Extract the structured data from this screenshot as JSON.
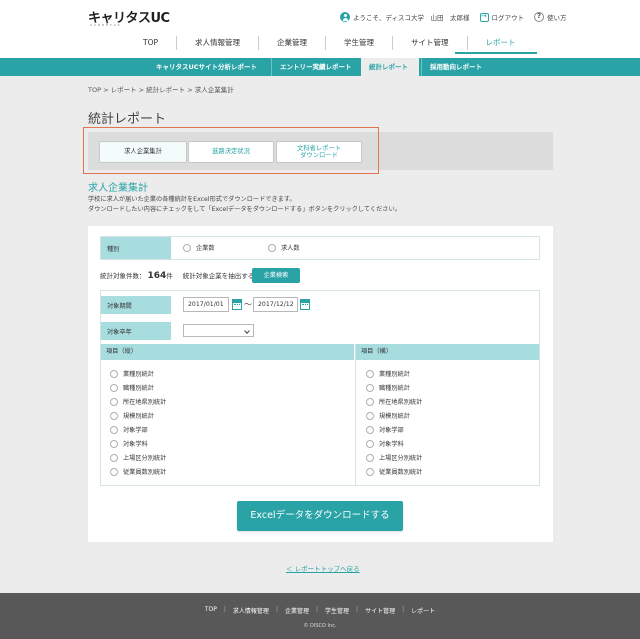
{
  "header": {
    "logo": "キャリタスUC",
    "logo_sub": "CAREETAS",
    "greeting": "ようこそ、ディスコ大学　山田　太郎様",
    "logout": "ログアウト",
    "help": "使い方"
  },
  "gnav": [
    "TOP",
    "求人情報管理",
    "企業管理",
    "学生管理",
    "サイト管理",
    "レポート"
  ],
  "subnav": [
    "キャリタスUCサイト分析レポート",
    "エントリー実績レポート",
    "統計レポート",
    "採用動向レポート"
  ],
  "breadcrumb": "TOP > レポート > 統計レポート > 求人企業集計",
  "page_title": "統計レポート",
  "tabs": {
    "t1": "求人企業集計",
    "t2": "進路決定状況",
    "t3_line1": "文科省レポート",
    "t3_line2": "ダウンロード"
  },
  "section_title": "求人企業集計",
  "description": {
    "line1": "学校に求人が届いた企業の各種統計をExcel形式でダウンロードできます。",
    "line2": "ダウンロードしたい内容にチェックをして「Excelデータをダウンロードする」ボタンをクリックしてください。"
  },
  "form": {
    "type_label": "種別",
    "type_opt1": "企業数",
    "type_opt2": "求人数",
    "count_label": "統計対象件数：",
    "count_value": "164",
    "count_unit": "件",
    "extract_label": "統計対象企業を抽出する",
    "search_button": "企業検索",
    "period_label": "対象期間",
    "date_from": "2017/01/01",
    "date_tilde": "～",
    "date_to": "2017/12/12",
    "grad_label": "対象卒年",
    "grad_value": "",
    "col_vertical": "項目（縦）",
    "col_horizontal": "項目（横）",
    "items_vertical": [
      "業種別統計",
      "職種別統計",
      "所在地県別統計",
      "規模別統計",
      "対象学部",
      "対象学科",
      "上場区分別統計",
      "従業員数別統計"
    ],
    "items_horizontal": [
      "業種別統計",
      "職種別統計",
      "所在地県別統計",
      "規模別統計",
      "対象学部",
      "対象学科",
      "上場区分別統計",
      "従業員数別統計"
    ]
  },
  "download_button": "Excelデータをダウンロードする",
  "back_link": "＜ レポートトップへ戻る",
  "footer": {
    "nav": [
      "TOP",
      "求人情報管理",
      "企業管理",
      "学生管理",
      "サイト管理",
      "レポート"
    ],
    "copyright": "© DISCO Inc."
  },
  "colors": {
    "accent": "#2aa3a7",
    "label_bg": "#a8dde0",
    "highlight": "#e07550",
    "footer_bg": "#585858"
  }
}
